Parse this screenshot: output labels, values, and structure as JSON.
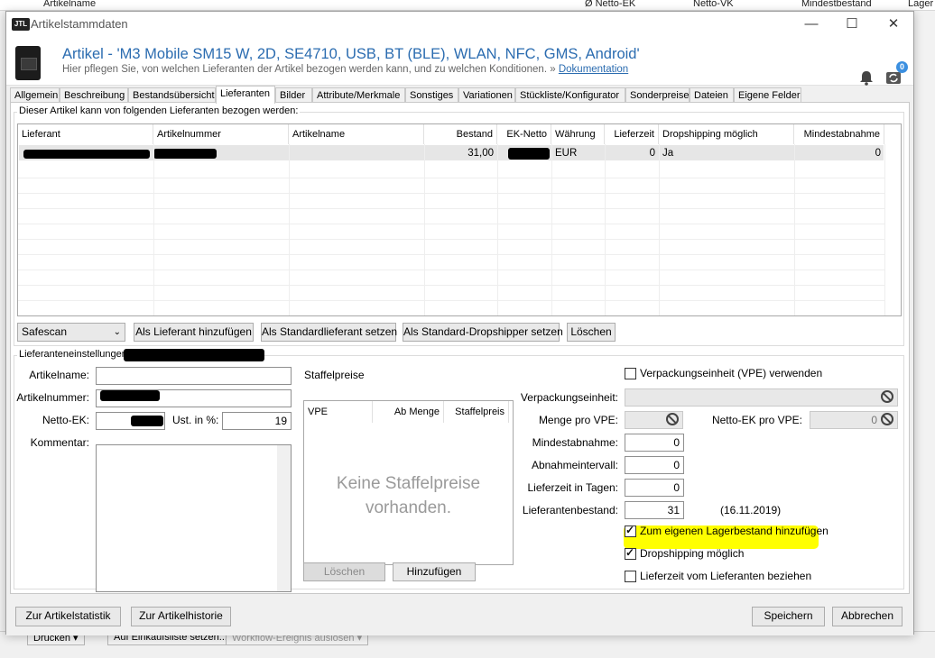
{
  "background": {
    "header_cols": [
      "Artikelname",
      "Ø Netto-EK",
      "Netto-VK",
      "Mindestbestand",
      "Lager"
    ],
    "buttons": [
      "Drucken",
      "Auf Einkaufsliste setzen...",
      "Workflow-Ereignis auslösen"
    ]
  },
  "window": {
    "title": "Artikelstammdaten",
    "minimize": "—",
    "maximize": "☐",
    "close": "✕",
    "logo": "JTL"
  },
  "header": {
    "title": "Artikel - 'M3 Mobile SM15 W, 2D, SE4710, USB, BT (BLE), WLAN, NFC, GMS, Android'",
    "subtitle": "Hier pflegen Sie, von welchen Lieferanten der Artikel bezogen werden kann, und zu welchen Konditionen.",
    "doc_prefix": "»",
    "doc_link": "Dokumentation",
    "notification_count": "0"
  },
  "tabs": [
    "Allgemein",
    "Beschreibung",
    "Bestandsübersicht",
    "Lieferanten",
    "Bilder",
    "Attribute/Merkmale",
    "Sonstiges",
    "Variationen",
    "Stückliste/Konfigurator",
    "Sonderpreise",
    "Dateien",
    "Eigene Felder"
  ],
  "supplier_group": {
    "label": "Dieser Artikel kann von folgenden Lieferanten bezogen werden:",
    "columns": [
      "Lieferant",
      "Artikelnummer",
      "Artikelname",
      "Bestand",
      "EK-Netto",
      "Währung",
      "Lieferzeit",
      "Dropshipping möglich",
      "Mindestabnahme"
    ],
    "rows": [
      {
        "bestand": "31,00",
        "waehrung": "EUR",
        "lieferzeit": "0",
        "dropshipping": "Ja",
        "mindestabnahme": "0"
      }
    ],
    "supplier_select": "Safescan",
    "buttons": {
      "add": "Als Lieferant hinzufügen",
      "standard": "Als Standardlieferant setzen",
      "dropshipper": "Als Standard-Dropshipper setzen",
      "delete": "Löschen"
    }
  },
  "settings": {
    "label": "Lieferanteneinstellungen",
    "artikelname_label": "Artikelname:",
    "artikelnummer_label": "Artikelnummer:",
    "netto_ek_label": "Netto-EK:",
    "ust_label": "Ust. in %:",
    "ust_value": "19",
    "kommentar_label": "Kommentar:",
    "staffel_label": "Staffelpreise",
    "staffel_cols": [
      "VPE",
      "Ab Menge",
      "Staffelpreis"
    ],
    "staffel_empty": "Keine Staffelpreise vorhanden.",
    "staffel_delete": "Löschen",
    "staffel_add": "Hinzufügen",
    "vpe_check": "Verpackungseinheit (VPE) verwenden",
    "vpe_label": "Verpackungseinheit:",
    "menge_vpe_label": "Menge pro VPE:",
    "netto_ek_vpe_label": "Netto-EK pro VPE:",
    "netto_ek_vpe_value": "0",
    "mindestabnahme_label": "Mindestabnahme:",
    "mindestabnahme_value": "0",
    "abnahmeintervall_label": "Abnahmeintervall:",
    "abnahmeintervall_value": "0",
    "lieferzeit_label": "Lieferzeit in Tagen:",
    "lieferzeit_value": "0",
    "lieferantenbestand_label": "Lieferantenbestand:",
    "lieferantenbestand_value": "31",
    "lieferantenbestand_date": "(16.11.2019)",
    "check_lagerbestand": "Zum eigenen Lagerbestand hinzufügen",
    "check_dropshipping": "Dropshipping möglich",
    "check_lieferzeit": "Lieferzeit vom Lieferanten beziehen"
  },
  "footer": {
    "stats": "Zur Artikelstatistik",
    "history": "Zur Artikelhistorie",
    "save": "Speichern",
    "cancel": "Abbrechen"
  },
  "colors": {
    "accent": "#2b6cb0",
    "highlight": "#ffff00",
    "badge": "#3b8fe0"
  }
}
